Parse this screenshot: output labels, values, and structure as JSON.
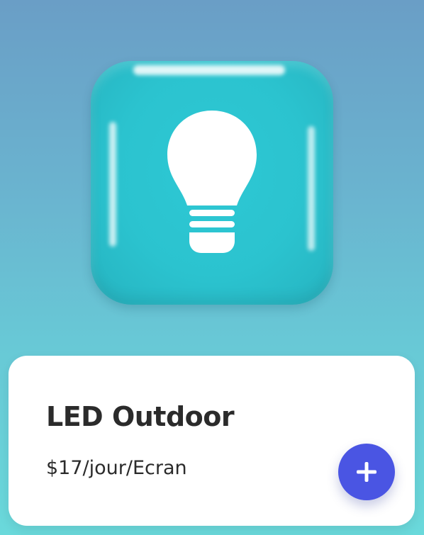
{
  "product": {
    "title": "LED Outdoor",
    "price": "$17/jour/Ecran",
    "icon": "lightbulb-icon",
    "tile_color": "#2bc3cf"
  },
  "actions": {
    "add_icon": "plus-icon",
    "add_button_color": "#4a55e3"
  }
}
